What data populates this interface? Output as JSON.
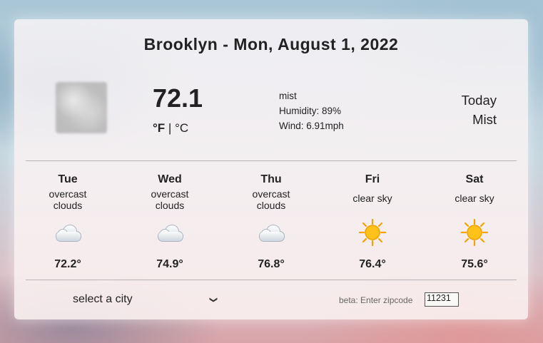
{
  "header": {
    "title": "Brooklyn - Mon, August 1, 2022"
  },
  "current": {
    "icon": "mist-icon",
    "temperature": "72.1",
    "unit_f": "°F",
    "unit_sep": " | ",
    "unit_c": "°C",
    "description": "mist",
    "humidity": "Humidity: 89%",
    "wind": "Wind: 6.91mph",
    "today_label": "Today",
    "today_condition": "Mist"
  },
  "forecast": [
    {
      "day": "Tue",
      "desc_line1": "overcast",
      "desc_line2": "clouds",
      "icon": "cloud-icon",
      "temp": "72.2°"
    },
    {
      "day": "Wed",
      "desc_line1": "overcast",
      "desc_line2": "clouds",
      "icon": "cloud-icon",
      "temp": "74.9°"
    },
    {
      "day": "Thu",
      "desc_line1": "overcast",
      "desc_line2": "clouds",
      "icon": "cloud-icon",
      "temp": "76.8°"
    },
    {
      "day": "Fri",
      "desc_line1": "clear sky",
      "desc_line2": "",
      "icon": "sun-icon",
      "temp": "76.4°"
    },
    {
      "day": "Sat",
      "desc_line1": "clear sky",
      "desc_line2": "",
      "icon": "sun-icon",
      "temp": "75.6°"
    }
  ],
  "controls": {
    "city_select": "select a city",
    "zip_label": "beta: Enter zipcode",
    "zip_value": "11231"
  }
}
